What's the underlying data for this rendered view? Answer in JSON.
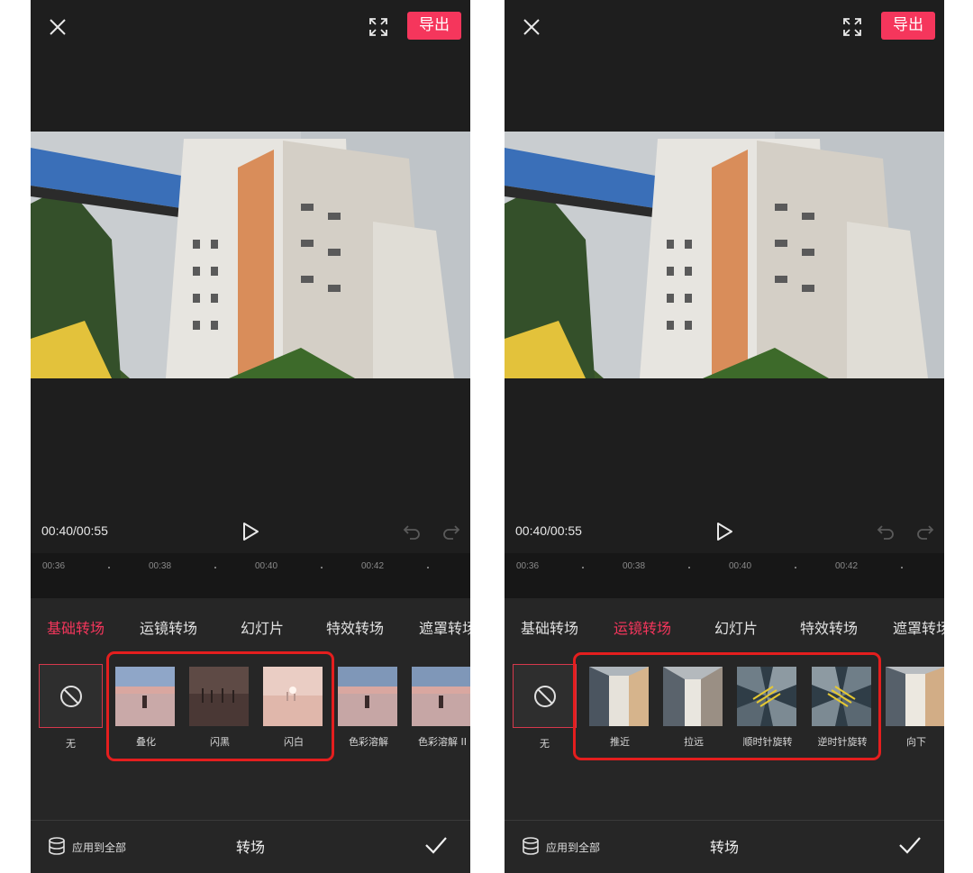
{
  "left": {
    "export_label": "导出",
    "time": "00:40/00:55",
    "ticks": [
      "00:36",
      "00:38",
      "00:40",
      "00:42"
    ],
    "tabs": [
      {
        "label": "基础转场",
        "active": true
      },
      {
        "label": "运镜转场",
        "active": false
      },
      {
        "label": "幻灯片",
        "active": false
      },
      {
        "label": "特效转场",
        "active": false
      },
      {
        "label": "遮罩转场",
        "active": false
      }
    ],
    "none_label": "无",
    "items": [
      "叠化",
      "闪黑",
      "闪白",
      "色彩溶解",
      "色彩溶解 II"
    ],
    "apply_all": "应用到全部",
    "panel_title": "转场"
  },
  "right": {
    "export_label": "导出",
    "time": "00:40/00:55",
    "ticks": [
      "00:36",
      "00:38",
      "00:40",
      "00:42"
    ],
    "tabs": [
      {
        "label": "基础转场",
        "active": false
      },
      {
        "label": "运镜转场",
        "active": true
      },
      {
        "label": "幻灯片",
        "active": false
      },
      {
        "label": "特效转场",
        "active": false
      },
      {
        "label": "遮罩转场",
        "active": false
      }
    ],
    "none_label": "无",
    "items": [
      "推近",
      "拉远",
      "顺时针旋转",
      "逆时针旋转",
      "向下"
    ],
    "apply_all": "应用到全部",
    "panel_title": "转场"
  },
  "colors": {
    "accent": "#f5365c",
    "highlight": "#e41e1e",
    "background": "#1e1e1e"
  },
  "icons": [
    "close-icon",
    "fullscreen-icon",
    "play-icon",
    "undo-icon",
    "redo-icon",
    "none-icon",
    "database-icon",
    "check-icon"
  ]
}
